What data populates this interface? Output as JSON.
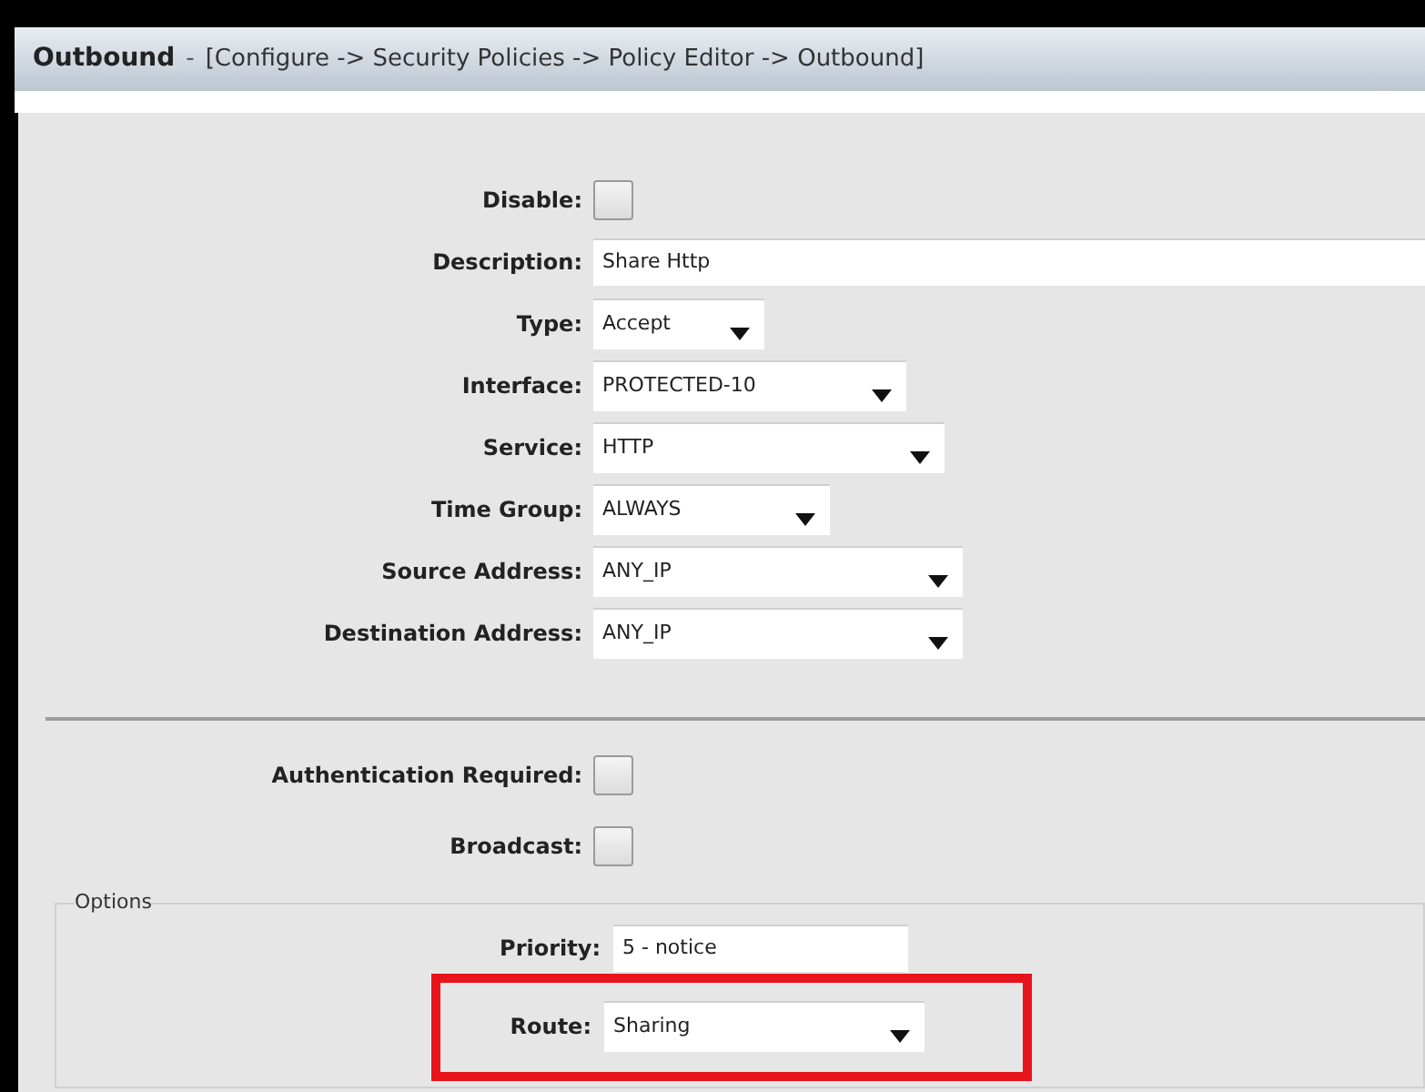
{
  "header": {
    "title": "Outbound",
    "separator": "-",
    "breadcrumb": "[Configure -> Security Policies -> Policy Editor -> Outbound]"
  },
  "fields": [
    {
      "kind": "checkbox",
      "label": "Disable:",
      "checked": false
    },
    {
      "kind": "text",
      "label": "Description:",
      "value": "Share Http"
    },
    {
      "kind": "select",
      "label": "Type:",
      "value": "Accept"
    },
    {
      "kind": "select",
      "label": "Interface:",
      "value": "PROTECTED-10"
    },
    {
      "kind": "select",
      "label": "Service:",
      "value": "HTTP"
    },
    {
      "kind": "select",
      "label": "Time Group:",
      "value": "ALWAYS"
    },
    {
      "kind": "select",
      "label": "Source Address:",
      "value": "ANY_IP"
    },
    {
      "kind": "select",
      "label": "Destination Address:",
      "value": "ANY_IP"
    }
  ],
  "flags": [
    {
      "kind": "checkbox",
      "label": "Authentication Required:",
      "checked": false
    },
    {
      "kind": "checkbox",
      "label": "Broadcast:",
      "checked": false
    }
  ],
  "options": {
    "legend": "Options",
    "fields": [
      {
        "kind": "text",
        "label": "Priority:",
        "value": "5 - notice",
        "highlighted": false
      },
      {
        "kind": "select",
        "label": "Route:",
        "value": "Sharing",
        "highlighted": true
      }
    ]
  }
}
